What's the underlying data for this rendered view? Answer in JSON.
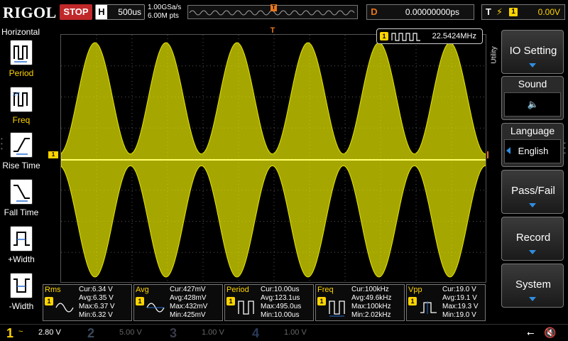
{
  "topbar": {
    "brand": "RIGOL",
    "run_state": "STOP",
    "timebase_letter": "H",
    "timebase": "500us",
    "sample_rate": "1.00GSa/s",
    "memory_depth": "6.00M pts",
    "delay_letter": "D",
    "delay": "0.00000000ps",
    "trigger_letter": "T",
    "trigger_edge": "rising-edge-icon",
    "trigger_source": "1",
    "trigger_level": "0.00V"
  },
  "left_menu": {
    "title": "Horizontal",
    "items": [
      {
        "label": "Period",
        "icon": "period-icon",
        "selected": true
      },
      {
        "label": "Freq",
        "icon": "frequency-icon",
        "selected": true
      },
      {
        "label": "Rise Time",
        "icon": "rise-time-icon",
        "selected": true
      },
      {
        "label": "Fall Time",
        "icon": "fall-time-icon",
        "selected": true
      },
      {
        "label": "+Width",
        "icon": "positive-width-icon",
        "selected": true
      },
      {
        "label": "-Width",
        "icon": "negative-width-icon",
        "selected": true
      }
    ]
  },
  "screen": {
    "ch1_marker": "1",
    "trigger_marker": "T",
    "freq_counter": {
      "channel": "1",
      "value": "22.5424MHz"
    },
    "waveform": {
      "type": "amplitude-modulated sine",
      "color": "#e6e600",
      "cycles_visible": 6,
      "modulation_depth": 0.95
    }
  },
  "measurements": [
    {
      "name": "Rms",
      "icon": "rms-icon",
      "channel": "1",
      "stats": [
        "Cur:6.34 V",
        "Avg:6.35 V",
        "Max:6.37 V",
        "Min:6.32 V"
      ]
    },
    {
      "name": "Avg",
      "icon": "average-icon",
      "channel": "1",
      "stats": [
        "Cur:427mV",
        "Avg:428mV",
        "Max:432mV",
        "Min:425mV"
      ]
    },
    {
      "name": "Period",
      "icon": "period-icon",
      "channel": "1",
      "stats": [
        "Cur:10.00us",
        "Avg:123.1us",
        "Max:495.0us",
        "Min:10.00us"
      ]
    },
    {
      "name": "Freq",
      "icon": "frequency-icon",
      "channel": "1",
      "stats": [
        "Cur:100kHz",
        "Avg:49.6kHz",
        "Max:100kHz",
        "Min:2.02kHz"
      ]
    },
    {
      "name": "Vpp",
      "icon": "vpp-icon",
      "channel": "1",
      "stats": [
        "Cur:19.0 V",
        "Avg:19.1 V",
        "Max:19.3 V",
        "Min:19.0 V"
      ]
    }
  ],
  "right_menu": {
    "tab": "Utility",
    "io_setting": "IO Setting",
    "sound_title": "Sound",
    "sound_icon": "speaker-icon",
    "language_title": "Language",
    "language_value": "English",
    "pass_fail": "Pass/Fail",
    "record": "Record",
    "system": "System"
  },
  "channels": [
    {
      "num": "1",
      "coupling": "~",
      "scale": "2.80 V",
      "color": "#ffd400",
      "active": true
    },
    {
      "num": "2",
      "coupling": "",
      "scale": "5.00 V",
      "color": "#2a8fd0",
      "active": false
    },
    {
      "num": "3",
      "coupling": "",
      "scale": "1.00 V",
      "color": "#c040c0",
      "active": false
    },
    {
      "num": "4",
      "coupling": "",
      "scale": "1.00 V",
      "color": "#2060d0",
      "active": false
    }
  ],
  "status_icons": [
    "usb-icon",
    "speaker-mute-icon"
  ]
}
